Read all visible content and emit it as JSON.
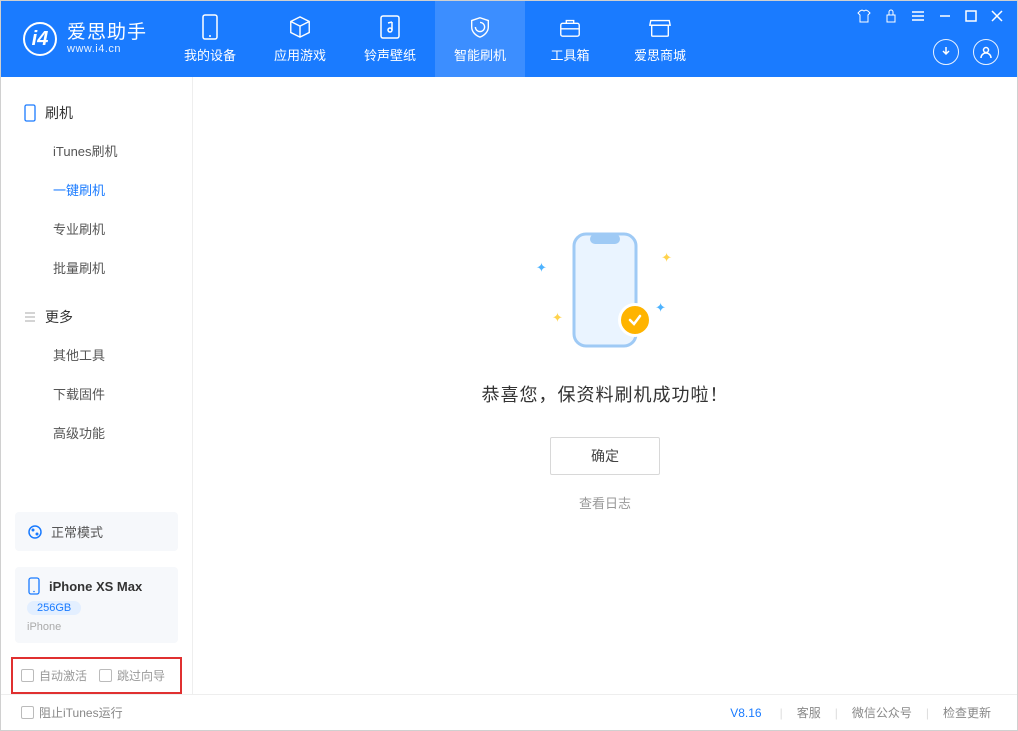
{
  "app": {
    "name": "爱思助手",
    "url": "www.i4.cn"
  },
  "nav": [
    {
      "label": "我的设备",
      "icon": "device"
    },
    {
      "label": "应用游戏",
      "icon": "cube"
    },
    {
      "label": "铃声壁纸",
      "icon": "music"
    },
    {
      "label": "智能刷机",
      "icon": "shield",
      "active": true
    },
    {
      "label": "工具箱",
      "icon": "toolbox"
    },
    {
      "label": "爱思商城",
      "icon": "store"
    }
  ],
  "sidebar": {
    "group1": {
      "title": "刷机"
    },
    "items1": [
      {
        "label": "iTunes刷机"
      },
      {
        "label": "一键刷机",
        "active": true
      },
      {
        "label": "专业刷机"
      },
      {
        "label": "批量刷机"
      }
    ],
    "group2": {
      "title": "更多"
    },
    "items2": [
      {
        "label": "其他工具"
      },
      {
        "label": "下载固件"
      },
      {
        "label": "高级功能"
      }
    ],
    "mode": "正常模式",
    "device": {
      "name": "iPhone XS Max",
      "capacity": "256GB",
      "type": "iPhone"
    },
    "opt_auto_activate": "自动激活",
    "opt_skip_wizard": "跳过向导"
  },
  "main": {
    "success_title": "恭喜您，保资料刷机成功啦！",
    "ok_label": "确定",
    "log_link": "查看日志"
  },
  "footer": {
    "block_itunes": "阻止iTunes运行",
    "version": "V8.16",
    "links": [
      "客服",
      "微信公众号",
      "检查更新"
    ]
  }
}
